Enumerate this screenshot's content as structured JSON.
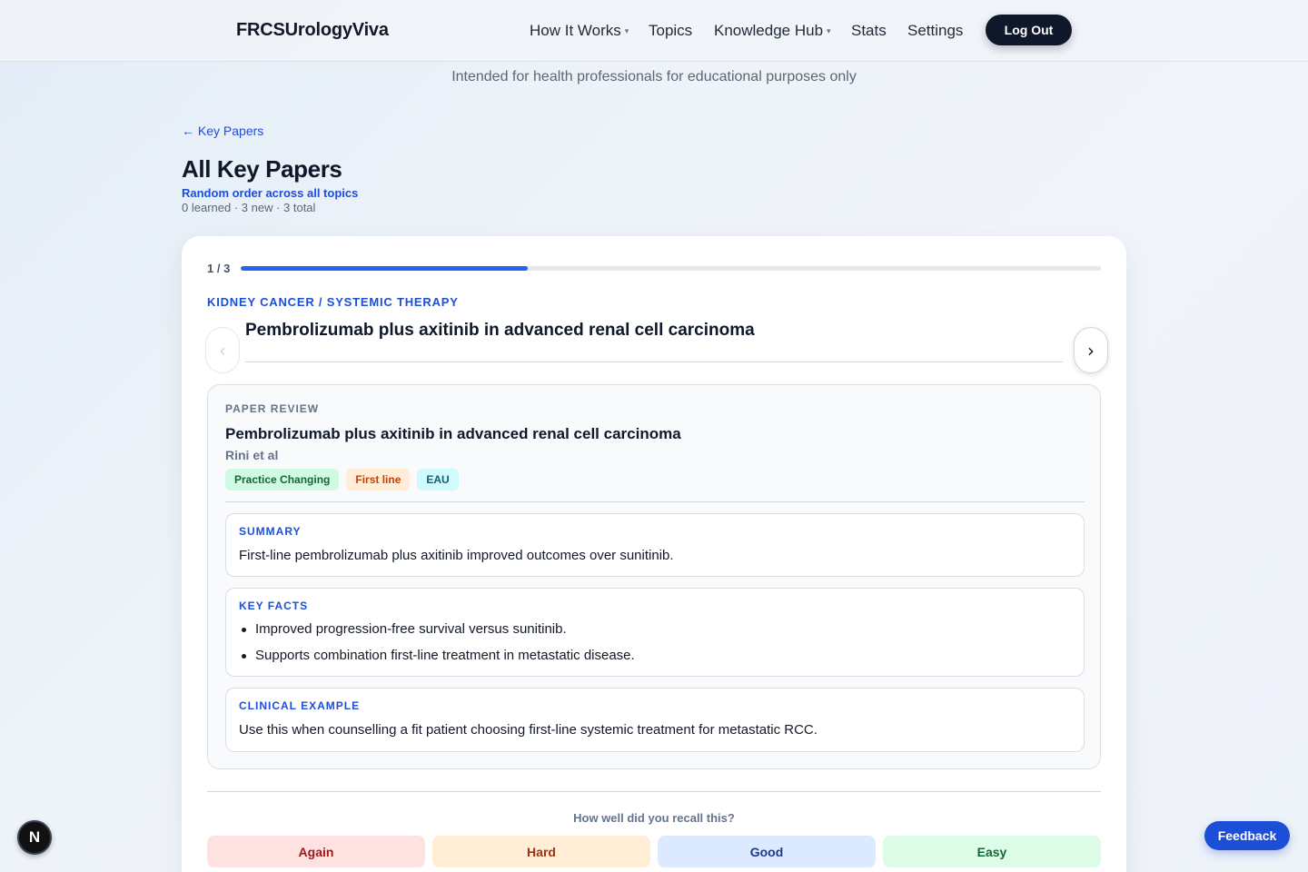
{
  "header": {
    "brand": "FRCSUrologyViva",
    "nav": [
      {
        "label": "How It Works",
        "has_dropdown": true
      },
      {
        "label": "Topics",
        "has_dropdown": false
      },
      {
        "label": "Knowledge Hub",
        "has_dropdown": true
      },
      {
        "label": "Stats",
        "has_dropdown": false
      },
      {
        "label": "Settings",
        "has_dropdown": false
      }
    ],
    "caret": "▾",
    "logout_label": "Log Out"
  },
  "disclaimer": "Intended for health professionals for educational purposes only",
  "back_link": "Key Papers",
  "back_icon": "←",
  "page": {
    "title": "All Key Papers",
    "subtitle": "Random order across all topics",
    "counts": "0 learned · 3 new · 3 total"
  },
  "card": {
    "progress_label": "1 / 3",
    "progress": {
      "current": 1,
      "total": 3
    },
    "topic": "Kidney cancer / Systemic therapy",
    "heading": "Pembrolizumab plus axitinib in advanced renal cell carcinoma",
    "prev_icon": "‹",
    "next_icon": "›",
    "review": {
      "kicker": "PAPER REVIEW",
      "title": "Pembrolizumab plus axitinib in advanced renal cell carcinoma",
      "authors": "Rini et al",
      "tags": [
        "Practice Changing",
        "First line",
        "EAU"
      ],
      "summary_title": "SUMMARY",
      "summary": "First-line pembrolizumab plus axitinib improved outcomes over sunitinib.",
      "facts_title": "KEY FACTS",
      "facts": [
        "Improved progression-free survival versus sunitinib.",
        "Supports combination first-line treatment in metastatic disease."
      ],
      "example_title": "CLINICAL EXAMPLE",
      "example": "Use this when counselling a fit patient choosing first-line systemic treatment for metastatic RCC."
    },
    "recall_question": "How well did you recall this?",
    "grades": [
      "Again",
      "Hard",
      "Good",
      "Easy"
    ]
  },
  "next_badge": "N",
  "feedback_label": "Feedback",
  "colors": {
    "accent": "#1d4ed8",
    "progress": "#2563eb",
    "again": "#fee2e2",
    "hard": "#ffedd5",
    "good": "#dbeafe",
    "easy": "#dcfce7"
  }
}
